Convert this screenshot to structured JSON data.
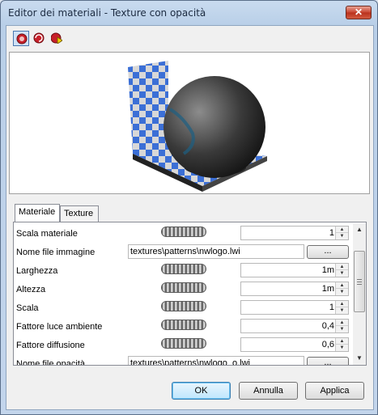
{
  "window": {
    "title": "Editor dei materiali - Texture con opacità",
    "close_glyph": "✕"
  },
  "toolbar": {
    "buttons": [
      "material-sphere-icon",
      "refresh-material-icon",
      "apply-material-icon"
    ]
  },
  "tabs": [
    {
      "label": "Materiale"
    },
    {
      "label": "Texture"
    }
  ],
  "properties": [
    {
      "label": "Scala materiale",
      "type": "number",
      "value": "1"
    },
    {
      "label": "Nome file immagine",
      "type": "file",
      "value": "textures\\patterns\\nwlogo.lwi",
      "button": "..."
    },
    {
      "label": "Larghezza",
      "type": "number",
      "value": "1m"
    },
    {
      "label": "Altezza",
      "type": "number",
      "value": "1m"
    },
    {
      "label": "Scala",
      "type": "number",
      "value": "1"
    },
    {
      "label": "Fattore luce ambiente",
      "type": "number",
      "value": "0,4"
    },
    {
      "label": "Fattore diffusione",
      "type": "number",
      "value": "0,6"
    },
    {
      "label": "Nome file opacità",
      "type": "file",
      "value": "textures\\patterns\\nwlogo_o.lwi",
      "button": "..."
    }
  ],
  "buttons": {
    "ok": "OK",
    "cancel": "Annulla",
    "apply": "Applica"
  },
  "colors": {
    "checker_blue": "#3b6fd6",
    "checker_light": "#d8d8d8",
    "sphere": "#3a3a3a"
  }
}
